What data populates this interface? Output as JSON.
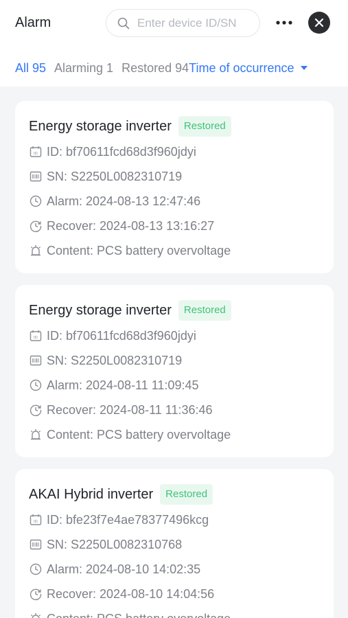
{
  "header": {
    "title": "Alarm",
    "search_placeholder": "Enter device ID/SN",
    "search_value": ""
  },
  "tabs": [
    {
      "label": "All 95",
      "active": true
    },
    {
      "label": "Alarming 1",
      "active": false
    },
    {
      "label": "Restored 94",
      "active": false
    }
  ],
  "sort": {
    "label": "Time of occurrence"
  },
  "colors": {
    "accent": "#3478f6",
    "badge_text": "#3fc37a",
    "badge_bg": "#e9f8ef",
    "close_bg": "#2b2d31"
  },
  "icons": {
    "search": "search-icon",
    "more": "more-dots-icon",
    "close": "close-icon",
    "id": "id-card-icon",
    "sn": "barcode-icon",
    "alarm": "clock-icon",
    "recover": "recover-clock-icon",
    "content": "alarm-bell-icon"
  },
  "cards": [
    {
      "name": "Energy storage inverter",
      "status": "Restored",
      "id": "ID: bf70611fcd68d3f960jdyi",
      "sn": "SN: S2250L0082310719",
      "alarm": "Alarm: 2024-08-13 12:47:46",
      "recover": "Recover: 2024-08-13 13:16:27",
      "content": "Content: PCS battery overvoltage"
    },
    {
      "name": "Energy storage inverter",
      "status": "Restored",
      "id": "ID: bf70611fcd68d3f960jdyi",
      "sn": "SN: S2250L0082310719",
      "alarm": "Alarm: 2024-08-11 11:09:45",
      "recover": "Recover: 2024-08-11 11:36:46",
      "content": "Content: PCS battery overvoltage"
    },
    {
      "name": "AKAI Hybrid inverter",
      "status": "Restored",
      "id": "ID: bfe23f7e4ae78377496kcg",
      "sn": "SN: S2250L0082310768",
      "alarm": "Alarm: 2024-08-10 14:02:35",
      "recover": "Recover: 2024-08-10 14:04:56",
      "content": "Content: PCS battery overvoltage"
    }
  ]
}
